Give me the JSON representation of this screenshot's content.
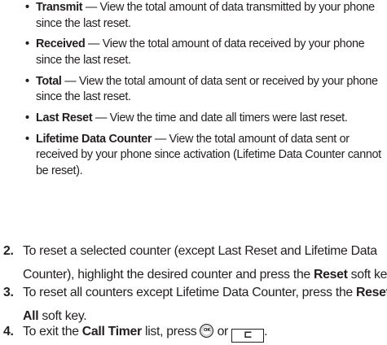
{
  "bullets": [
    {
      "term": "Transmit",
      "text": " — View the total amount of data transmitted by your phone since the last reset."
    },
    {
      "term": "Received",
      "text": " — View the total amount of data received by your phone since the last reset."
    },
    {
      "term": "Total",
      "text": " — View the total amount of data sent or received by your phone since the last reset."
    },
    {
      "term": "Last Reset",
      "text": " — View the time and date all timers were last reset."
    },
    {
      "term": "Lifetime Data Counter",
      "text": " — View the total amount of data sent or received by your phone since activation (Lifetime Data Counter cannot be reset)."
    }
  ],
  "steps": {
    "step2": {
      "number": "2.",
      "text_before": "To reset a selected counter (except Last Reset and Lifetime Data Counter), highlight the desired counter and press the ",
      "key": "Reset",
      "text_after": " soft key."
    },
    "step3": {
      "number": "3.",
      "text_before": "To reset all counters except Lifetime Data Counter, press the ",
      "key": "Reset All",
      "text_after": " soft key."
    },
    "step4": {
      "number": "4.",
      "text_before": "To exit the ",
      "key": "Call Timer",
      "text_middle": " list, press ",
      "ok_label": "OK",
      "text_or": " or ",
      "back_symbol": "⊏",
      "text_after": "."
    }
  }
}
